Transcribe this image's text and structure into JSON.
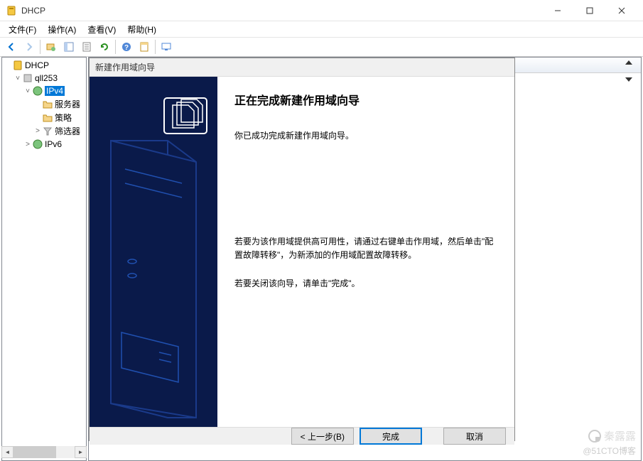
{
  "window": {
    "title": "DHCP"
  },
  "menu": {
    "file": "文件(F)",
    "action": "操作(A)",
    "view": "查看(V)",
    "help": "帮助(H)"
  },
  "tree": {
    "root": "DHCP",
    "server": "qll253",
    "ipv4": "IPv4",
    "ipv4_children": [
      "服务器",
      "策略",
      "筛选器"
    ],
    "ipv6": "IPv6"
  },
  "wizard": {
    "title": "新建作用域向导",
    "heading": "正在完成新建作用域向导",
    "success": "你已成功完成新建作用域向导。",
    "ha_text": "若要为该作用域提供高可用性，请通过右键单击作用域，然后单击\"配置故障转移\"，为新添加的作用域配置故障转移。",
    "close_text": "若要关闭该向导，请单击\"完成\"。",
    "back": "< 上一步(B)",
    "finish": "完成",
    "cancel": "取消"
  },
  "watermark": {
    "name": "秦露露",
    "site": "@51CTO博客"
  }
}
